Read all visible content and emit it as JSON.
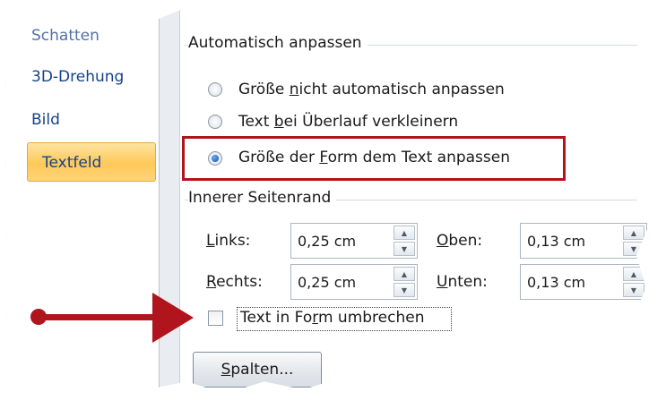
{
  "nav": {
    "partial_item": "Schatten",
    "items": [
      "3D-Drehung",
      "Bild"
    ],
    "active": "Textfeld"
  },
  "autofit": {
    "title": "Automatisch anpassen",
    "options": [
      {
        "pre": "Größe ",
        "key": "n",
        "post": "icht automatisch anpassen",
        "checked": false
      },
      {
        "pre": "Text ",
        "key": "b",
        "post": "ei Überlauf verkleinern",
        "checked": false
      },
      {
        "pre": "Größe der ",
        "key": "F",
        "post": "orm dem Text anpassen",
        "checked": true
      }
    ]
  },
  "margins": {
    "title": "Innerer Seitenrand",
    "left": {
      "key": "L",
      "rest": "inks:",
      "value": "0,25 cm"
    },
    "top": {
      "key": "O",
      "rest": "ben:",
      "value": "0,13 cm"
    },
    "right": {
      "key": "R",
      "rest": "echts:",
      "value": "0,25 cm"
    },
    "bottom": {
      "key": "U",
      "rest": "nten:",
      "value": "0,13 cm"
    }
  },
  "wrap": {
    "pre": "Text in Fo",
    "key": "r",
    "post": "m umbrechen",
    "checked": false
  },
  "columns_button": {
    "key": "S",
    "rest": "palten..."
  },
  "colors": {
    "highlight": "#b0141c",
    "active_tab": "#ffc859",
    "nav_text": "#15428b"
  },
  "icons": {
    "spin_up": "▲",
    "spin_down": "▼"
  }
}
